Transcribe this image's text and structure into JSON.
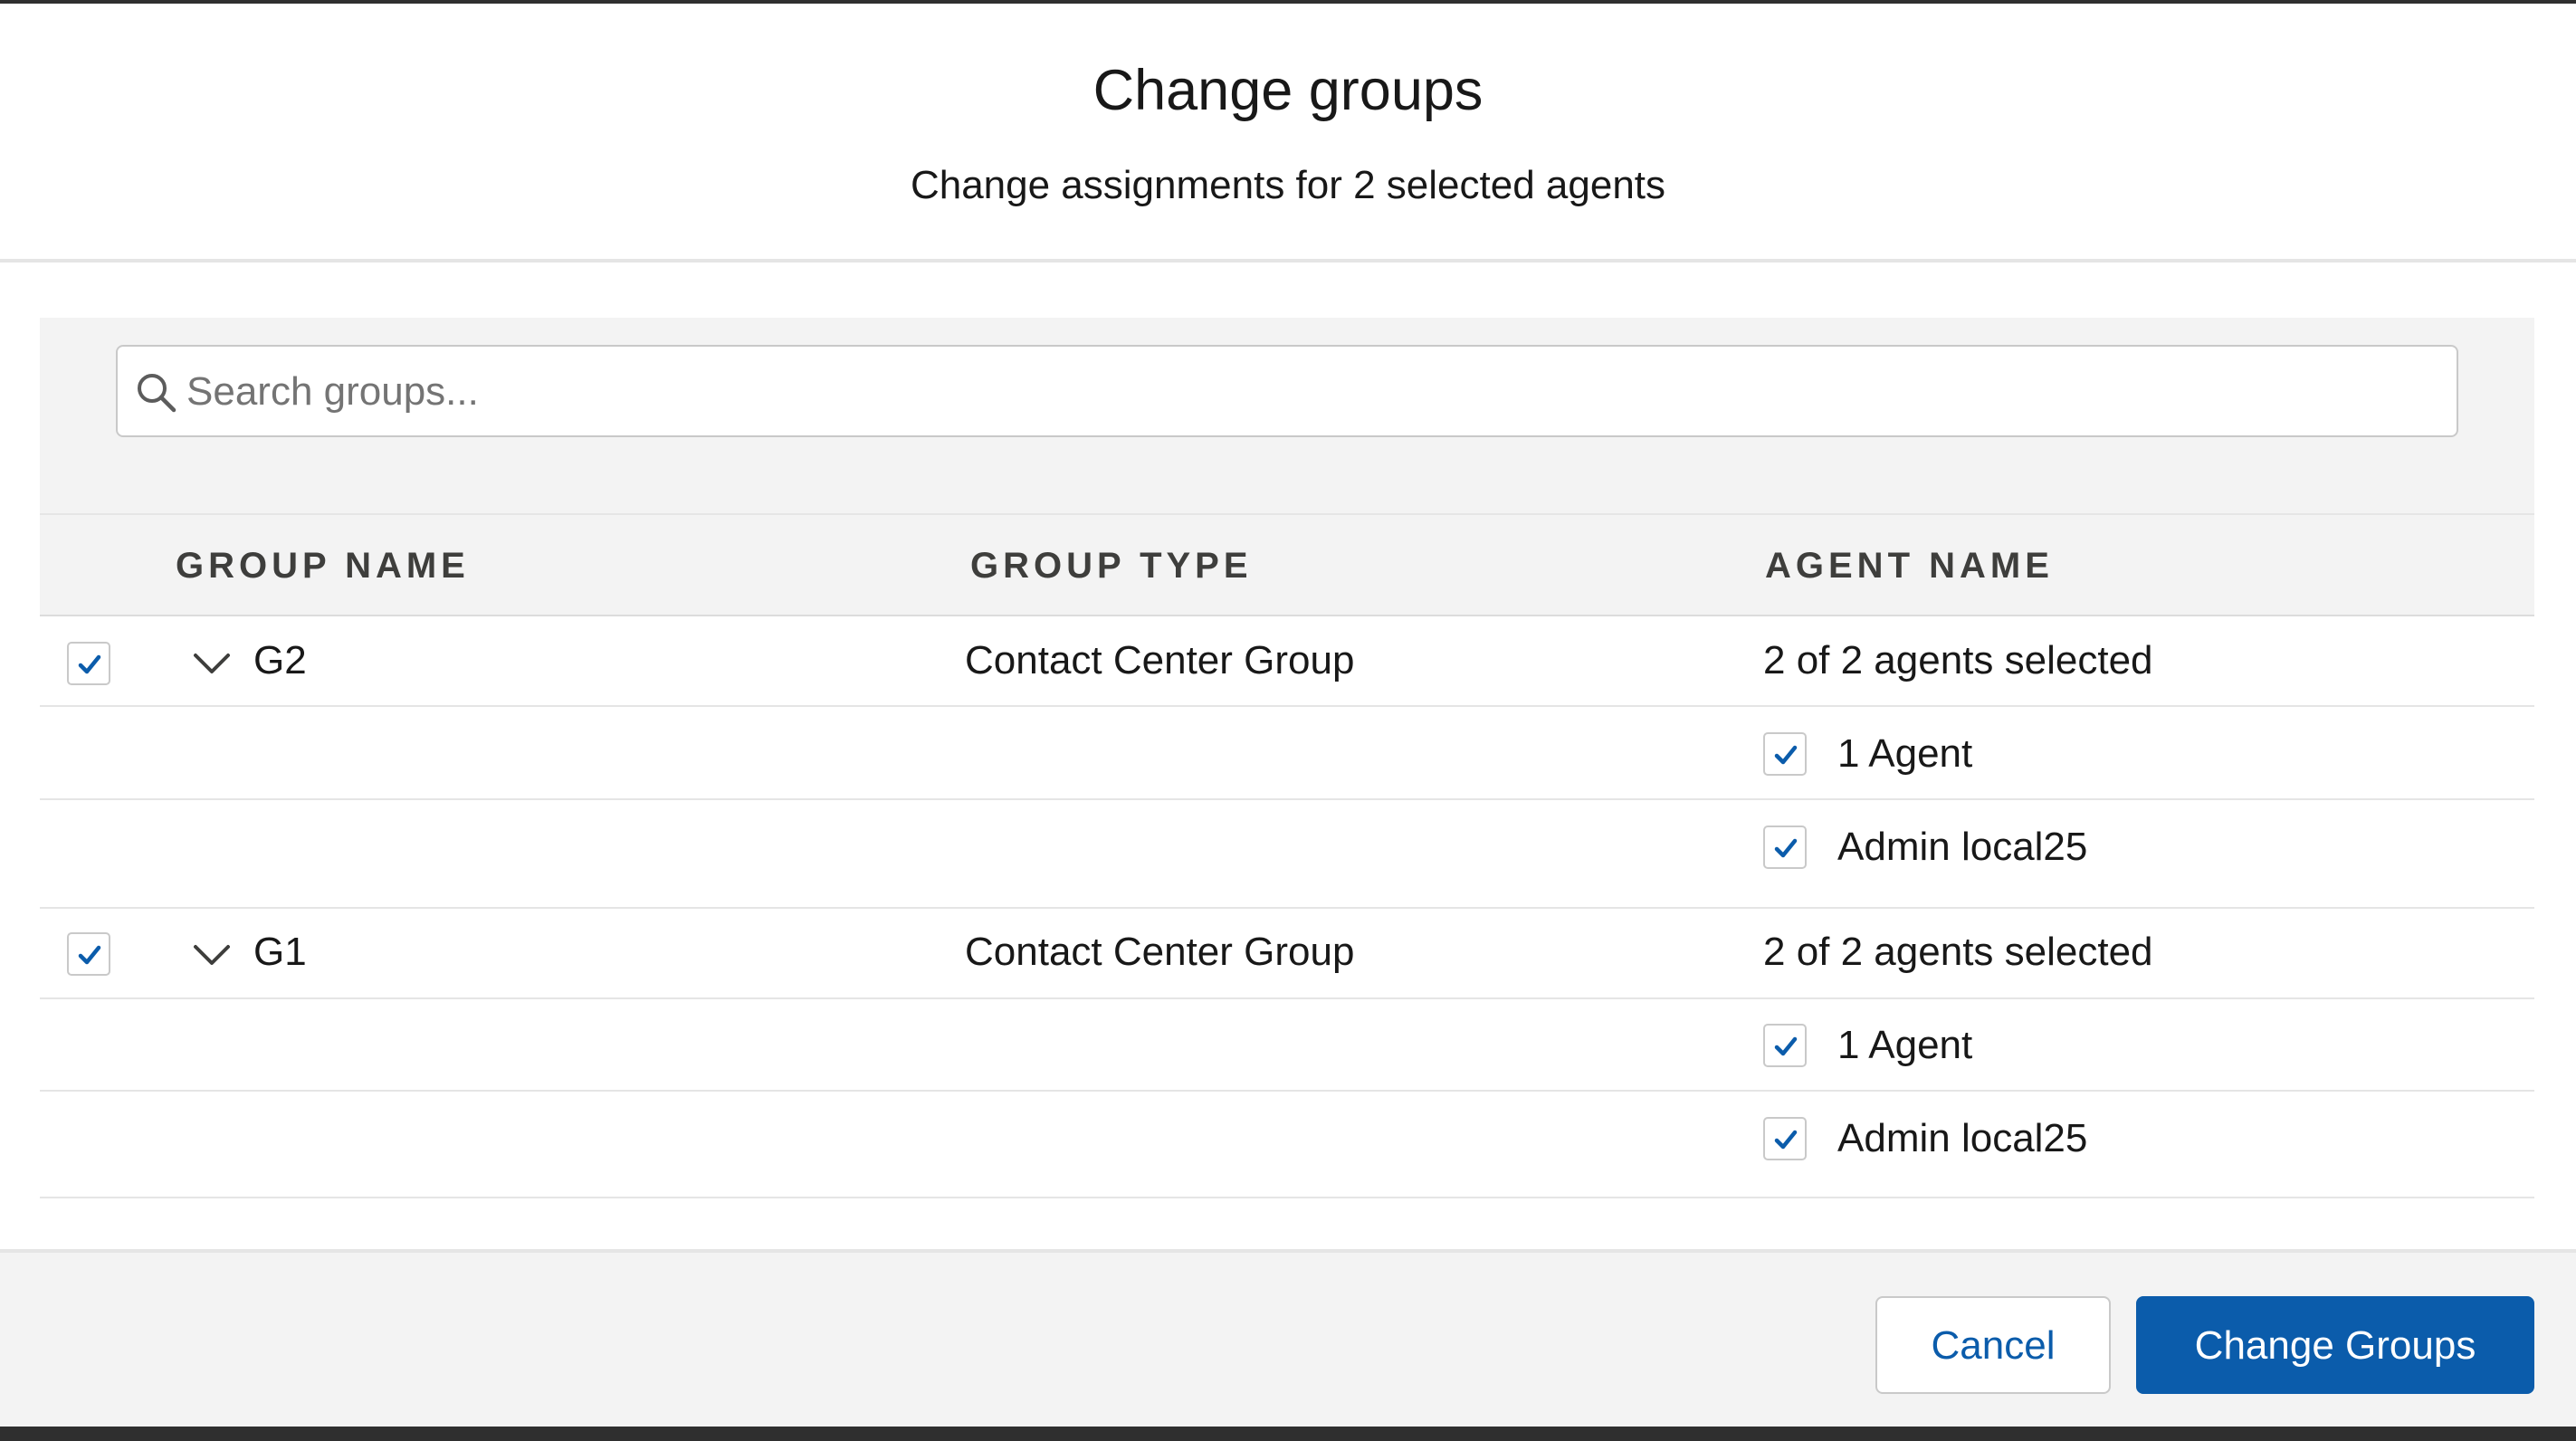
{
  "modal": {
    "title": "Change groups",
    "subtitle": "Change assignments for 2 selected agents"
  },
  "search": {
    "placeholder": "Search groups...",
    "icon": "search-icon"
  },
  "table": {
    "columns": [
      "GROUP NAME",
      "GROUP TYPE",
      "AGENT NAME"
    ],
    "groups": [
      {
        "name": "G2",
        "type": "Contact Center Group",
        "agents_summary": "2 of 2 agents selected",
        "checked": true,
        "expanded": true,
        "agents": [
          {
            "name": "1 Agent",
            "checked": true
          },
          {
            "name": "Admin local25",
            "checked": true
          }
        ]
      },
      {
        "name": "G1",
        "type": "Contact Center Group",
        "agents_summary": "2 of 2 agents selected",
        "checked": true,
        "expanded": true,
        "agents": [
          {
            "name": "1 Agent",
            "checked": true
          },
          {
            "name": "Admin local25",
            "checked": true
          }
        ]
      }
    ]
  },
  "footer": {
    "cancel_label": "Cancel",
    "submit_label": "Change Groups"
  },
  "colors": {
    "brand": "#0b5cab",
    "panel_bg": "#f3f3f3",
    "border": "#c9c9c9"
  }
}
